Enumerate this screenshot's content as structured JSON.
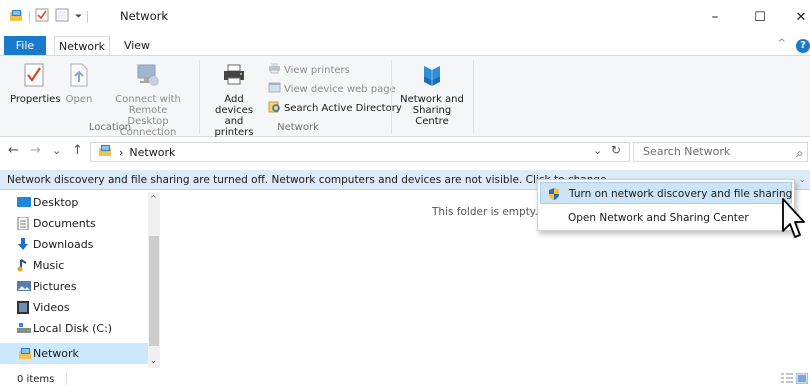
{
  "title_bar": {
    "title": "Network",
    "minimize": "–",
    "maximize": "☐",
    "close": "✕",
    "qa_dropdown": "⏷"
  },
  "ribbon_tabs": {
    "file": "File",
    "network": "Network",
    "view": "View",
    "collapse": "^",
    "help": "?"
  },
  "ribbon": {
    "location_group": {
      "label": "Location",
      "properties": "Properties",
      "open": "Open",
      "connect_remote": [
        "Connect with Remote",
        "Desktop Connection"
      ]
    },
    "network_group": {
      "label": "Network",
      "add_devices": [
        "Add devices",
        "and printers"
      ],
      "view_printers": "View printers",
      "view_device_web_page": "View device web page",
      "search_ad": "Search Active Directory"
    },
    "sharing": {
      "network_sharing_centre": [
        "Network and",
        "Sharing Centre"
      ]
    }
  },
  "address_bar": {
    "back": "←",
    "forward": "→",
    "recent": "⌄",
    "up": "↑",
    "path": "Network",
    "separator": "›",
    "refresh": "↻",
    "dropdown": "⌄",
    "search_placeholder": "Search Network",
    "search_icon": "⌕"
  },
  "info_bar": {
    "text": "Network discovery and file sharing are turned off. Network computers and devices are not visible. Click to change..."
  },
  "nav_pane": {
    "items": [
      {
        "label": "Desktop",
        "icon": "desktop-icon"
      },
      {
        "label": "Documents",
        "icon": "documents-icon"
      },
      {
        "label": "Downloads",
        "icon": "downloads-icon"
      },
      {
        "label": "Music",
        "icon": "music-icon"
      },
      {
        "label": "Pictures",
        "icon": "pictures-icon"
      },
      {
        "label": "Videos",
        "icon": "videos-icon"
      },
      {
        "label": "Local Disk (C:)",
        "icon": "local-disk-icon"
      },
      {
        "label": "Network",
        "icon": "network-icon",
        "selected": true
      }
    ]
  },
  "content": {
    "empty_message": "This folder is empty."
  },
  "popup_menu": {
    "items": [
      {
        "label": "Turn on network discovery and file sharing",
        "highlighted": true,
        "icon": "shield-icon"
      },
      {
        "label": "Open Network and Sharing Center",
        "highlighted": false
      }
    ]
  },
  "status_bar": {
    "items_count": "0 items"
  },
  "colors": {
    "accent": "#1979ca",
    "info_bar": "#dcebf7",
    "selection": "#cce8ff"
  }
}
